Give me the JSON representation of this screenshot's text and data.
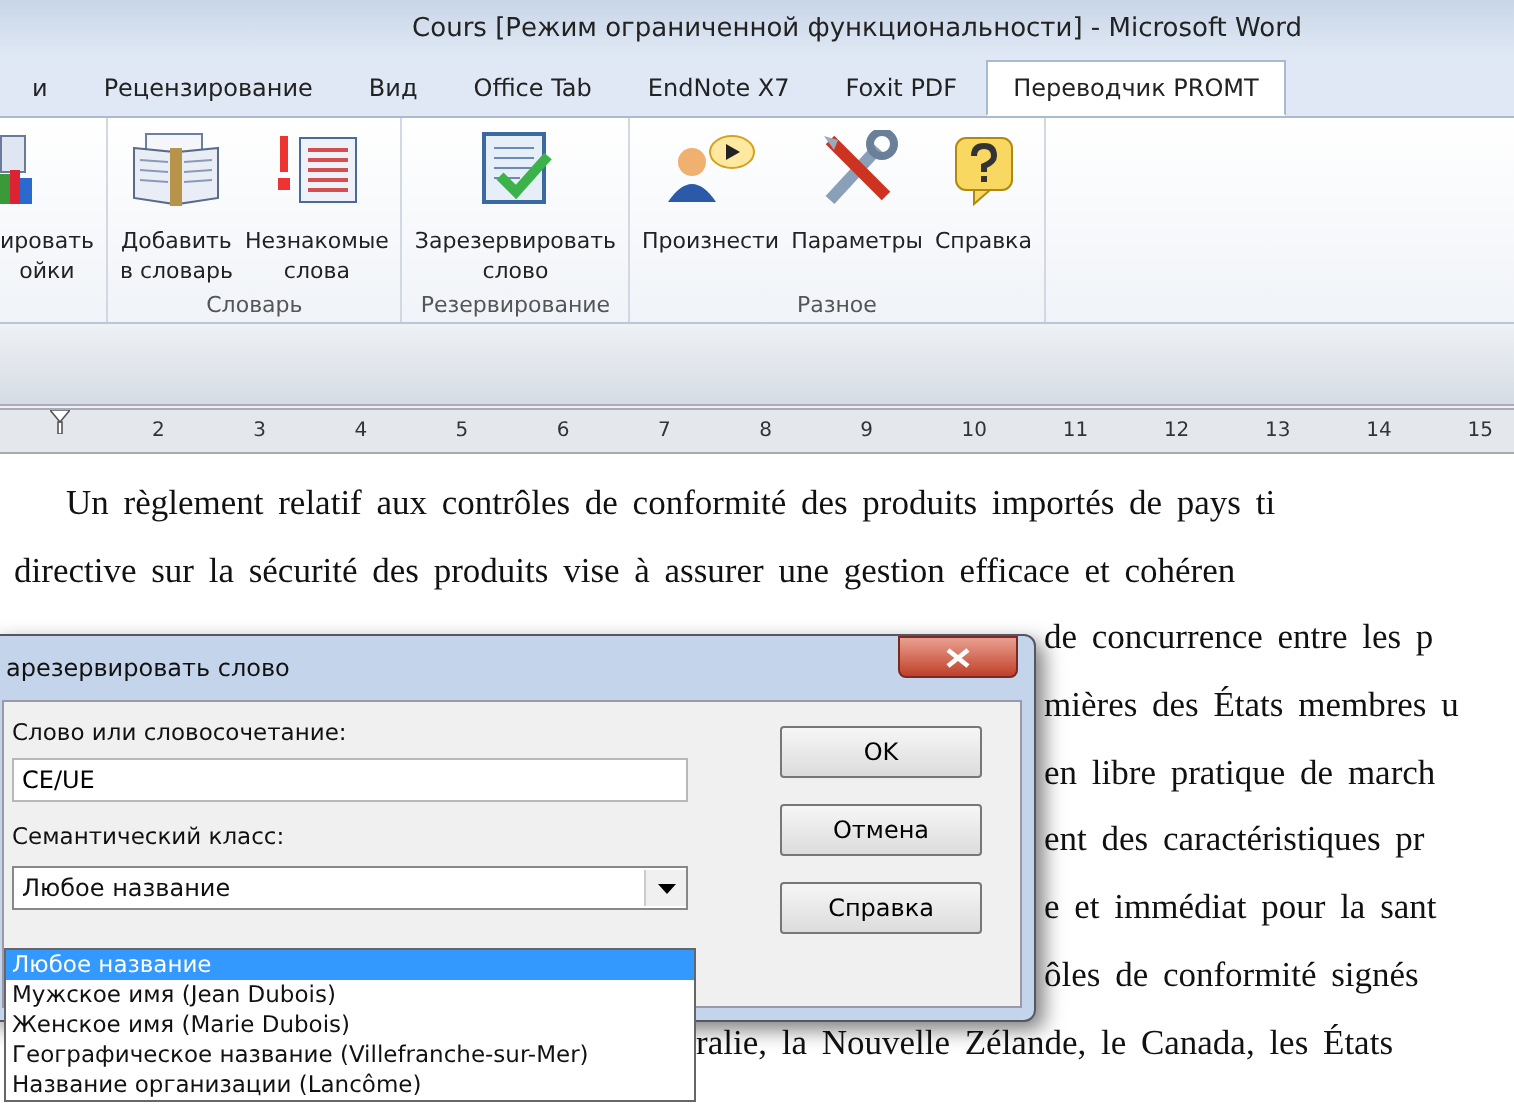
{
  "window": {
    "title": "Cours [Режим ограниченной функциональности]  -  Microsoft Word"
  },
  "tabs": [
    {
      "label": "и",
      "selected": false
    },
    {
      "label": "Рецензирование",
      "selected": false
    },
    {
      "label": "Вид",
      "selected": false
    },
    {
      "label": "Office Tab",
      "selected": false
    },
    {
      "label": "EndNote X7",
      "selected": false
    },
    {
      "label": "Foxit PDF",
      "selected": false
    },
    {
      "label": "Переводчик PROMT",
      "selected": true
    }
  ],
  "ribbon_groups": [
    {
      "buttons": [
        {
          "lines": [
            "ировать",
            "ойки"
          ]
        }
      ]
    },
    {
      "label": "Словарь",
      "buttons": [
        {
          "lines": [
            "Добавить",
            "в словарь"
          ]
        },
        {
          "lines": [
            "Незнакомые",
            "слова"
          ]
        }
      ]
    },
    {
      "label": "Резервирование",
      "buttons": [
        {
          "lines": [
            "Зарезервировать",
            "слово"
          ]
        }
      ]
    },
    {
      "label": "Разное",
      "buttons": [
        {
          "lines": [
            "Произнести"
          ]
        },
        {
          "lines": [
            "Параметры"
          ]
        },
        {
          "lines": [
            "Справка"
          ]
        }
      ]
    }
  ],
  "ruler": [
    "2",
    "3",
    "4",
    "5",
    "6",
    "7",
    "8",
    "9",
    "10",
    "11",
    "12",
    "13",
    "14",
    "15"
  ],
  "document": [
    {
      "kind": "indent",
      "text": "Un règlement relatif aux contrôles de conformité des produits importés de pays ti"
    },
    {
      "kind": "full",
      "text": "directive sur la sécurité des produits vise à assurer une gestion efficace et cohéren"
    },
    {
      "kind": "covered",
      "text": "de concurrence entre les p"
    },
    {
      "kind": "covered",
      "text": "mières des États membres u"
    },
    {
      "kind": "covered",
      "text": "en libre pratique de march"
    },
    {
      "kind": "covered",
      "text": "ent des caractéristiques pr"
    },
    {
      "kind": "covered",
      "text": "e et immédiat pour la sant"
    },
    {
      "kind": "covered",
      "text": "ôles de conformité signés"
    },
    {
      "kind": "below",
      "text": "ralie, la Nouvelle Zélande, le Canada, les États"
    }
  ],
  "dialog": {
    "title": "арезервировать слово",
    "word_label": "Слово или словосочетание:",
    "word_value": "CE/UE",
    "class_label": "Семантический класс:",
    "class_value": "Любое название",
    "buttons": [
      "OK",
      "Отмена",
      "Справка"
    ],
    "options": [
      {
        "label": "Любое название",
        "selected": true
      },
      {
        "label": "Мужское имя (Jean Dubois)",
        "selected": false
      },
      {
        "label": "Женское имя (Marie Dubois)",
        "selected": false
      },
      {
        "label": "Географическое название (Villefranche-sur-Mer)",
        "selected": false
      },
      {
        "label": "Название организации (Lancôme)",
        "selected": false
      }
    ]
  }
}
